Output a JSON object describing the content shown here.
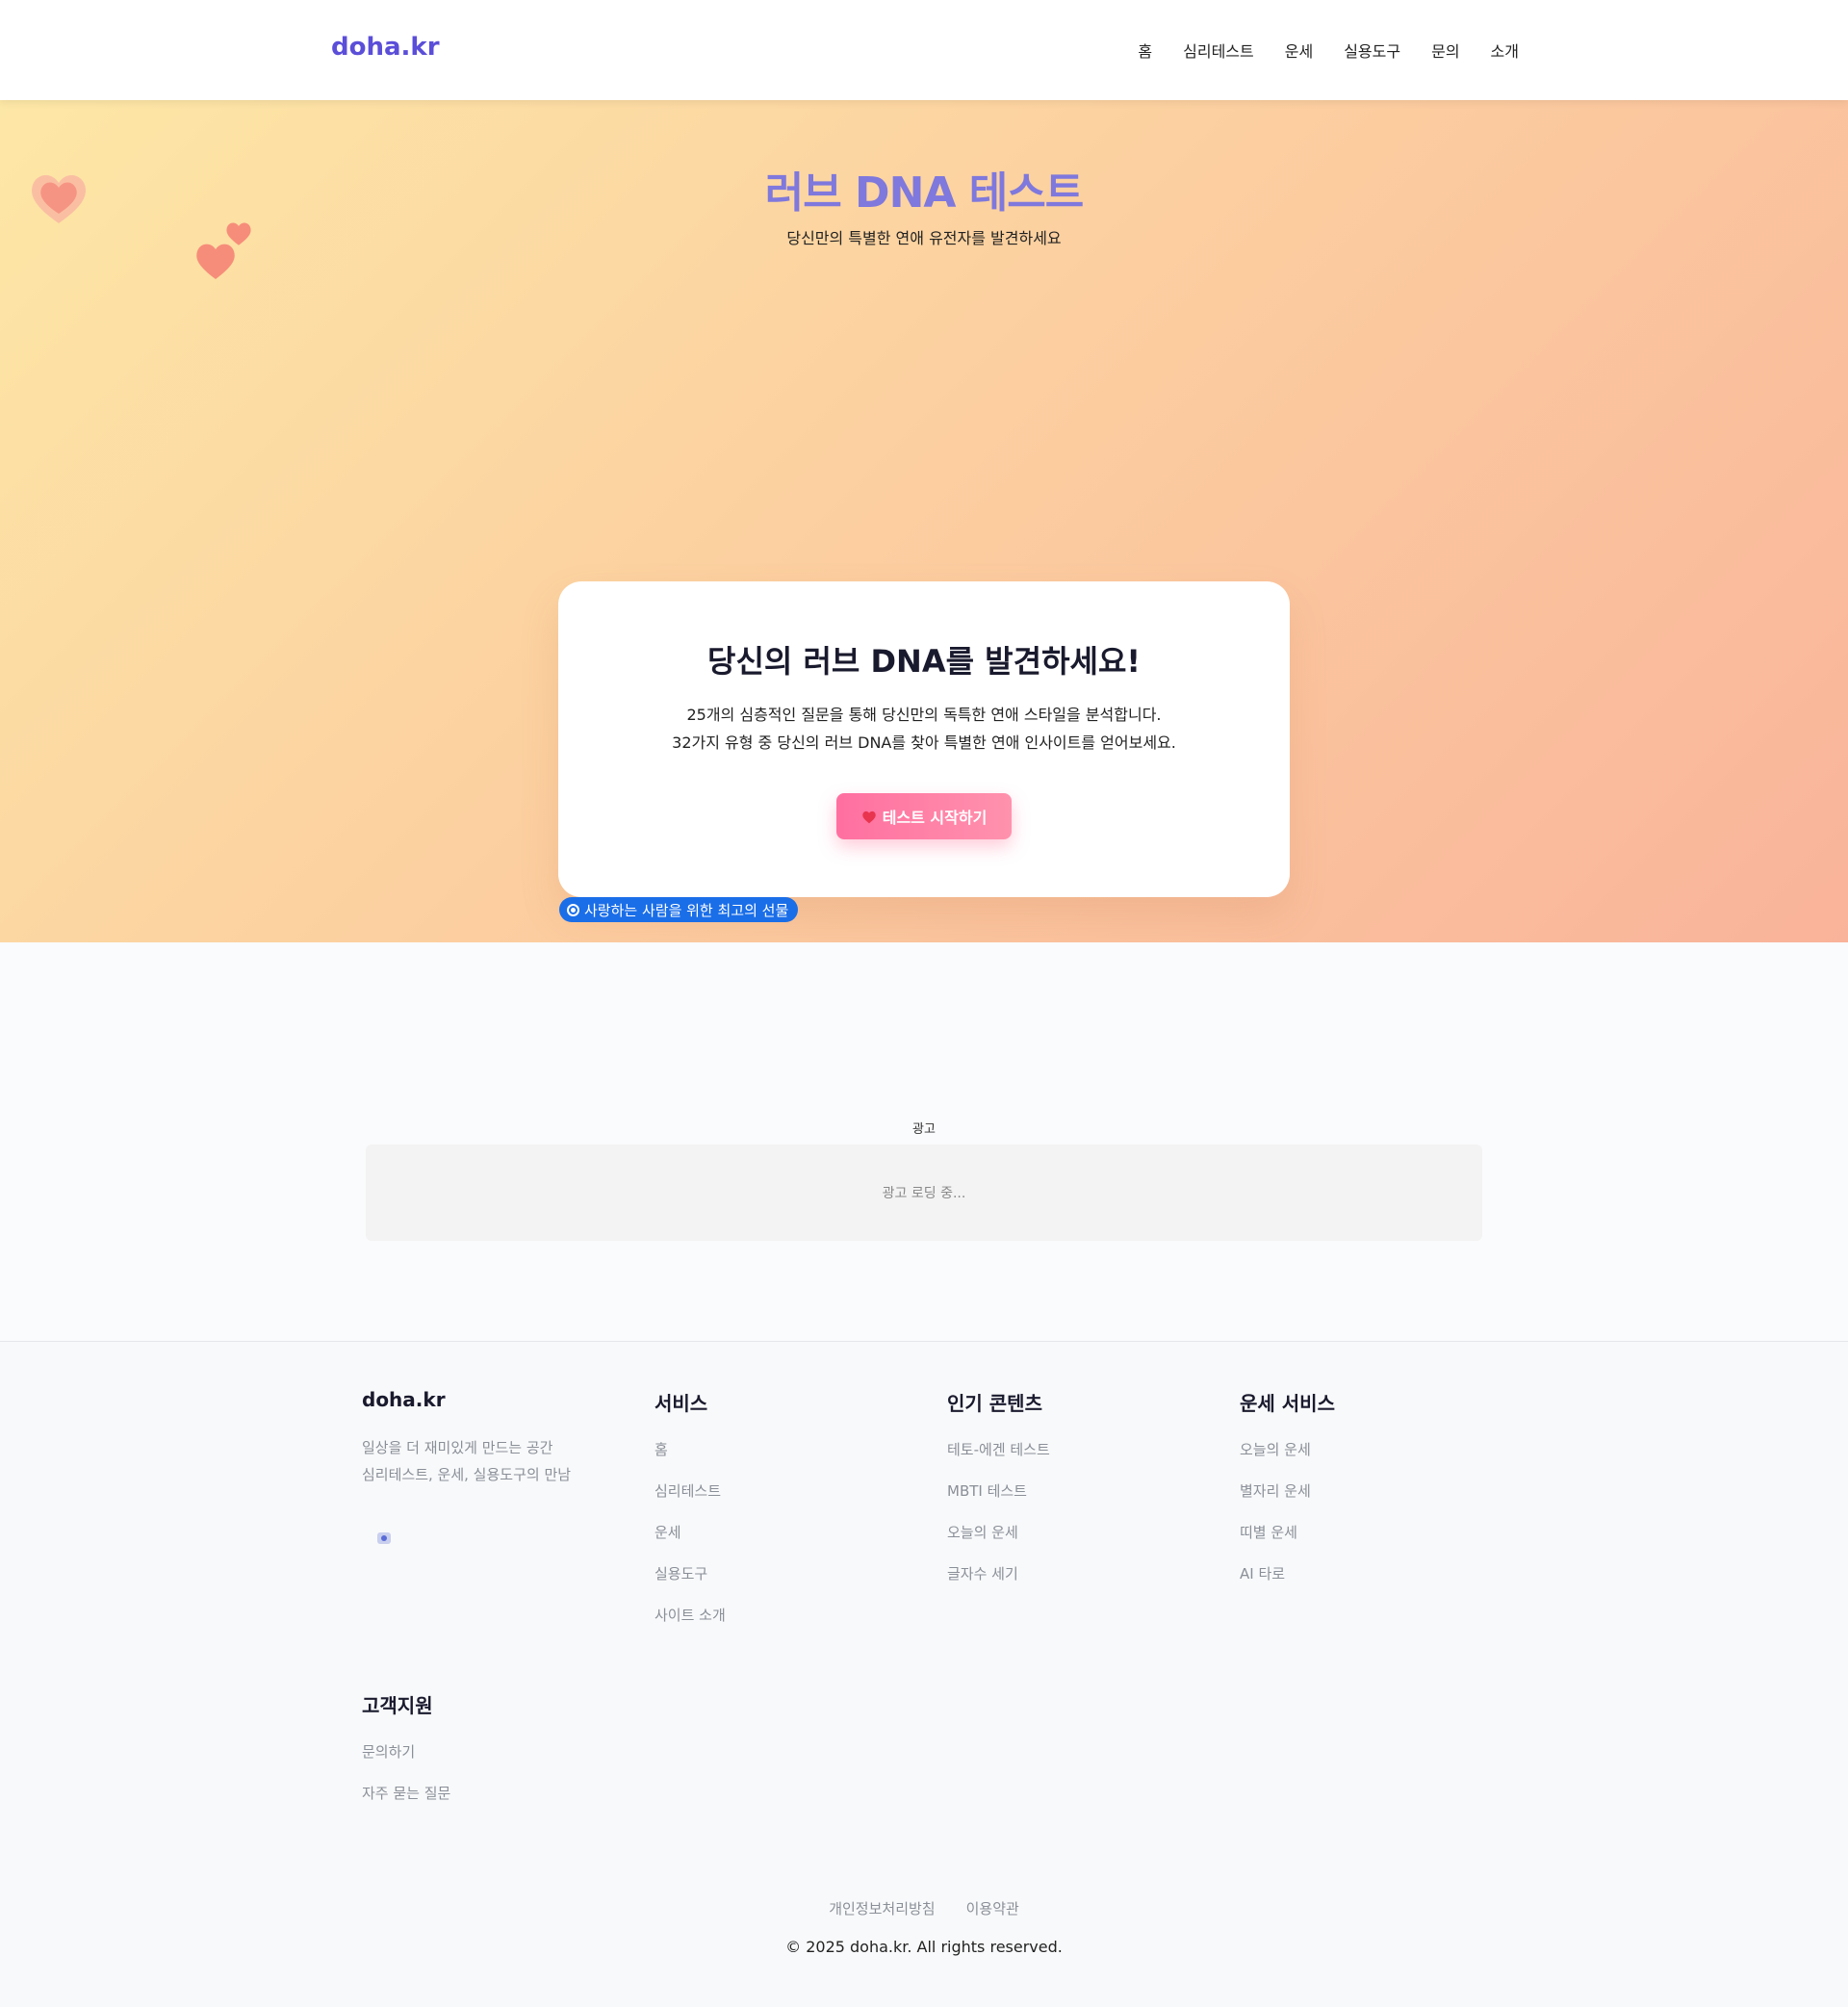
{
  "nav": {
    "logo": "doha.kr",
    "links": [
      "홈",
      "심리테스트",
      "운세",
      "실용도구",
      "문의",
      "소개"
    ]
  },
  "hero": {
    "title": "러브 DNA 테스트",
    "subtitle": "당신만의 특별한 연애 유전자를 발견하세요"
  },
  "card": {
    "title": "당신의 러브 DNA를 발견하세요!",
    "desc_line1": "25개의 심층적인 질문을 통해 당신만의 독특한 연애 스타일을 분석합니다.",
    "desc_line2": "32가지 유형 중 당신의 러브 DNA를 찾아 특별한 연애 인사이트를 얻어보세요.",
    "button": "테스트 시작하기",
    "button_icon": "heart-icon"
  },
  "badge": {
    "text": "사랑하는 사람을 위한 최고의 선물"
  },
  "ad": {
    "label": "광고",
    "loading": "광고 로딩 중..."
  },
  "footer": {
    "brand": {
      "title": "doha.kr",
      "line1": "일상을 더 재미있게 만드는 공간",
      "line2": "심리테스트, 운세, 실용도구의 만남"
    },
    "services": {
      "title": "서비스",
      "items": [
        "홈",
        "심리테스트",
        "운세",
        "실용도구",
        "사이트 소개"
      ]
    },
    "popular": {
      "title": "인기 콘텐츠",
      "items": [
        "테토-에겐 테스트",
        "MBTI 테스트",
        "오늘의 운세",
        "글자수 세기"
      ]
    },
    "fortune": {
      "title": "운세 서비스",
      "items": [
        "오늘의 운세",
        "별자리 운세",
        "띠별 운세",
        "AI 타로"
      ]
    },
    "support": {
      "title": "고객지원",
      "items": [
        "문의하기",
        "자주 묻는 질문"
      ]
    },
    "bottom_links": [
      "개인정보처리방침",
      "이용약관"
    ],
    "copyright": "© 2025 doha.kr. All rights reserved."
  },
  "colors": {
    "brand": "#5b4ed8",
    "hero_title": "#7f78dd",
    "button": "#ff6fa0",
    "badge": "#1a6ee8"
  }
}
